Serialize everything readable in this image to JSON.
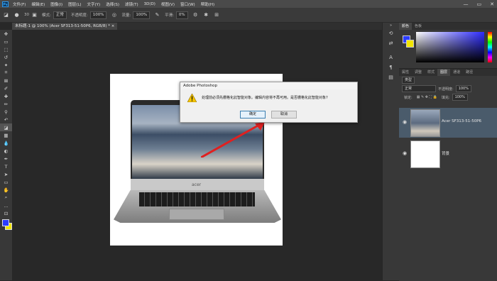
{
  "app": {
    "logo": "Ps"
  },
  "menu": [
    "文件(F)",
    "编辑(E)",
    "图像(I)",
    "图层(L)",
    "文字(Y)",
    "选择(S)",
    "滤镜(T)",
    "3D(D)",
    "视图(V)",
    "窗口(W)",
    "帮助(H)"
  ],
  "window_controls": [
    "—",
    "▭",
    "✕"
  ],
  "options": {
    "brush_size": "30",
    "mode_label": "模式:",
    "mode_value": "正常",
    "opacity_label": "不透明度:",
    "opacity_value": "100%",
    "flow_label": "流量:",
    "flow_value": "100%",
    "smooth_label": "平滑:",
    "smooth_value": "0%"
  },
  "document_tab": "未标题-1 @ 100% (Acer SF313-51-50P6, RGB/8) * ×",
  "laptop_brand": "acer",
  "dialog": {
    "title": "Adobe Photoshop",
    "message": "处理前必须先栅格化此智能对象。编辑内容将不再可用。是否栅格化此智能对象?",
    "ok": "确定",
    "cancel": "取消"
  },
  "color_panel": {
    "tabs": [
      "颜色",
      "色板"
    ],
    "fg": "#2b3cff",
    "bg": "#f2e600"
  },
  "layers_panel": {
    "tabs": [
      "属性",
      "调整",
      "样式",
      "图层",
      "通道",
      "路径"
    ],
    "filter_kind": "类型",
    "blend_mode": "正常",
    "opacity_label": "不透明度:",
    "opacity_value": "100%",
    "lock_label": "锁定:",
    "fill_label": "填充:",
    "fill_value": "100%",
    "layers": [
      {
        "name": "Acer SF313-51-50P6",
        "selected": true
      },
      {
        "name": "背景",
        "selected": false
      }
    ]
  }
}
